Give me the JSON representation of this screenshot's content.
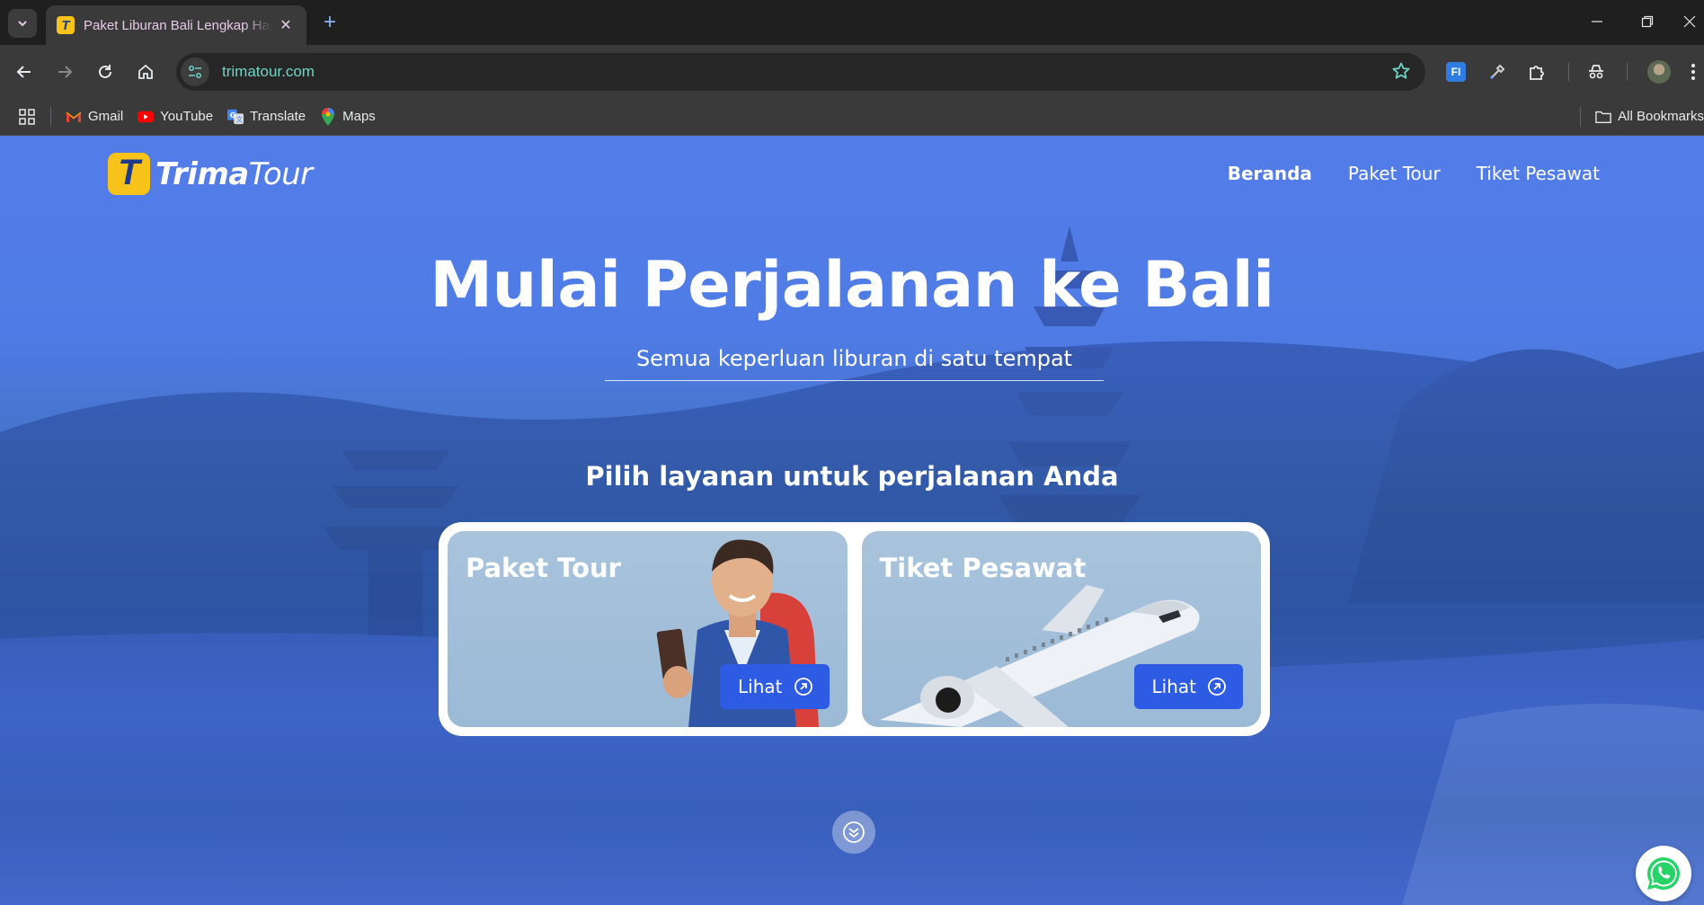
{
  "browser": {
    "tab": {
      "title": "Paket Liburan Bali Lengkap Harga Terjangkau",
      "favicon_letter": "T"
    },
    "url": "trimatour.com",
    "bookmarks": [
      {
        "label": "Gmail",
        "icon": "gmail-icon"
      },
      {
        "label": "YouTube",
        "icon": "youtube-icon"
      },
      {
        "label": "Translate",
        "icon": "translate-icon"
      },
      {
        "label": "Maps",
        "icon": "maps-icon"
      }
    ],
    "all_bookmarks": "All Bookmarks"
  },
  "site": {
    "logo": {
      "mark": "T",
      "bold": "Trima",
      "rest": "Tour"
    },
    "nav": [
      {
        "label": "Beranda",
        "active": true
      },
      {
        "label": "Paket Tour",
        "active": false
      },
      {
        "label": "Tiket Pesawat",
        "active": false
      }
    ],
    "hero": {
      "title": "Mulai Perjalanan ke Bali",
      "subtitle": "Semua keperluan liburan di satu tempat"
    },
    "services": {
      "heading": "Pilih layanan untuk perjalanan Anda",
      "cards": [
        {
          "title": "Paket Tour",
          "button": "Lihat"
        },
        {
          "title": "Tiket Pesawat",
          "button": "Lihat"
        }
      ]
    }
  },
  "colors": {
    "accent": "#2d5be3",
    "overlay": "#3b69e6",
    "logo_yellow": "#f7c21a",
    "whatsapp": "#25d366"
  }
}
